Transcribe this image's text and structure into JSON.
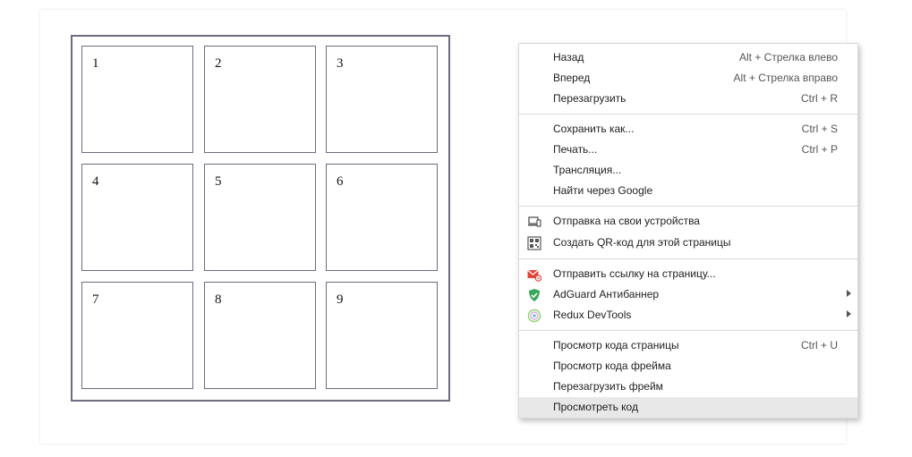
{
  "grid": {
    "cells": [
      "1",
      "2",
      "3",
      "4",
      "5",
      "6",
      "7",
      "8",
      "9"
    ]
  },
  "context_menu": {
    "groups": [
      [
        {
          "label": "Назад",
          "shortcut": "Alt + Стрелка влево"
        },
        {
          "label": "Вперед",
          "shortcut": "Alt + Стрелка вправо"
        },
        {
          "label": "Перезагрузить",
          "shortcut": "Ctrl + R"
        }
      ],
      [
        {
          "label": "Сохранить как...",
          "shortcut": "Ctrl + S"
        },
        {
          "label": "Печать...",
          "shortcut": "Ctrl + P"
        },
        {
          "label": "Трансляция...",
          "shortcut": ""
        },
        {
          "label": "Найти через Google",
          "shortcut": ""
        }
      ],
      [
        {
          "label": "Отправка на свои устройства",
          "shortcut": "",
          "icon": "devices-icon"
        },
        {
          "label": "Создать QR-код для этой страницы",
          "shortcut": "",
          "icon": "qr-code-icon"
        }
      ],
      [
        {
          "label": "Отправить ссылку на страницу...",
          "shortcut": "",
          "icon": "mail-link-icon"
        },
        {
          "label": "AdGuard Антибаннер",
          "shortcut": "",
          "icon": "adguard-shield-icon",
          "submenu": true
        },
        {
          "label": "Redux DevTools",
          "shortcut": "",
          "icon": "redux-devtools-icon",
          "submenu": true
        }
      ],
      [
        {
          "label": "Просмотр кода страницы",
          "shortcut": "Ctrl + U"
        },
        {
          "label": "Просмотр кода фрейма",
          "shortcut": ""
        },
        {
          "label": "Перезагрузить фрейм",
          "shortcut": ""
        },
        {
          "label": "Просмотреть код",
          "shortcut": "",
          "highlighted": true
        }
      ]
    ]
  },
  "colors": {
    "grid_border": "#6c6c80",
    "menu_highlight": "#e8e8e8",
    "adguard_green": "#3aa65b",
    "mail_red": "#e0453a"
  }
}
